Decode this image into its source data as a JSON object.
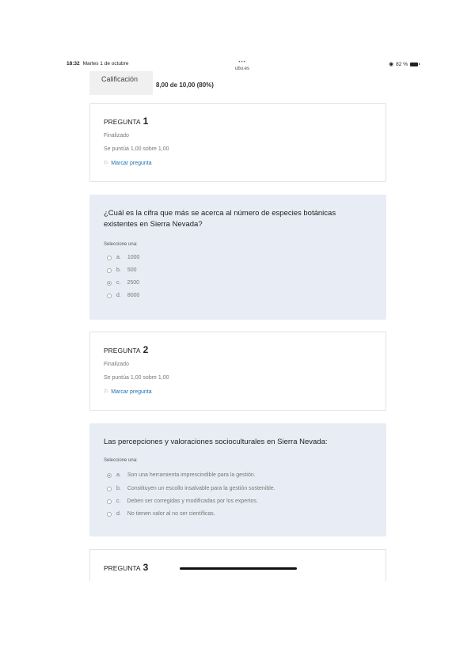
{
  "status_bar": {
    "time": "18:32",
    "date": "Martes 1 de octubre",
    "dots": "•••",
    "url": "ubu.es",
    "battery": "82 %"
  },
  "grade": {
    "label": "Calificación",
    "value": "8,00 de 10,00 (80%)"
  },
  "questions": [
    {
      "label": "PREGUNTA",
      "number": "1",
      "status": "Finalizado",
      "score": "Se puntúa 1,00 sobre 1,00",
      "flag": "Marcar pregunta",
      "text": "¿Cuál es la cifra que más se acerca al número de especies botánicas existentes en Sierra Nevada?",
      "select_one": "Seleccione una:",
      "options": [
        {
          "letter": "a.",
          "text": "1000",
          "selected": false
        },
        {
          "letter": "b.",
          "text": "500",
          "selected": false
        },
        {
          "letter": "c.",
          "text": "2500",
          "selected": true
        },
        {
          "letter": "d.",
          "text": "8000",
          "selected": false
        }
      ]
    },
    {
      "label": "PREGUNTA",
      "number": "2",
      "status": "Finalizado",
      "score": "Se puntúa 1,00 sobre 1,00",
      "flag": "Marcar pregunta",
      "text": "Las percepciones y valoraciones socioculturales en Sierra Nevada:",
      "select_one": "Seleccione una:",
      "options": [
        {
          "letter": "a.",
          "text": "Son una herramienta imprescindible para la gestión.",
          "selected": true
        },
        {
          "letter": "b.",
          "text": "Constituyen un escollo insalvable para la gestión sostenible.",
          "selected": false
        },
        {
          "letter": "c.",
          "text": "Deben ser corregidas y modificadas por los expertos.",
          "selected": false
        },
        {
          "letter": "d.",
          "text": "No tienen valor al no ser científicas.",
          "selected": false
        }
      ]
    },
    {
      "label": "PREGUNTA",
      "number": "3"
    }
  ]
}
